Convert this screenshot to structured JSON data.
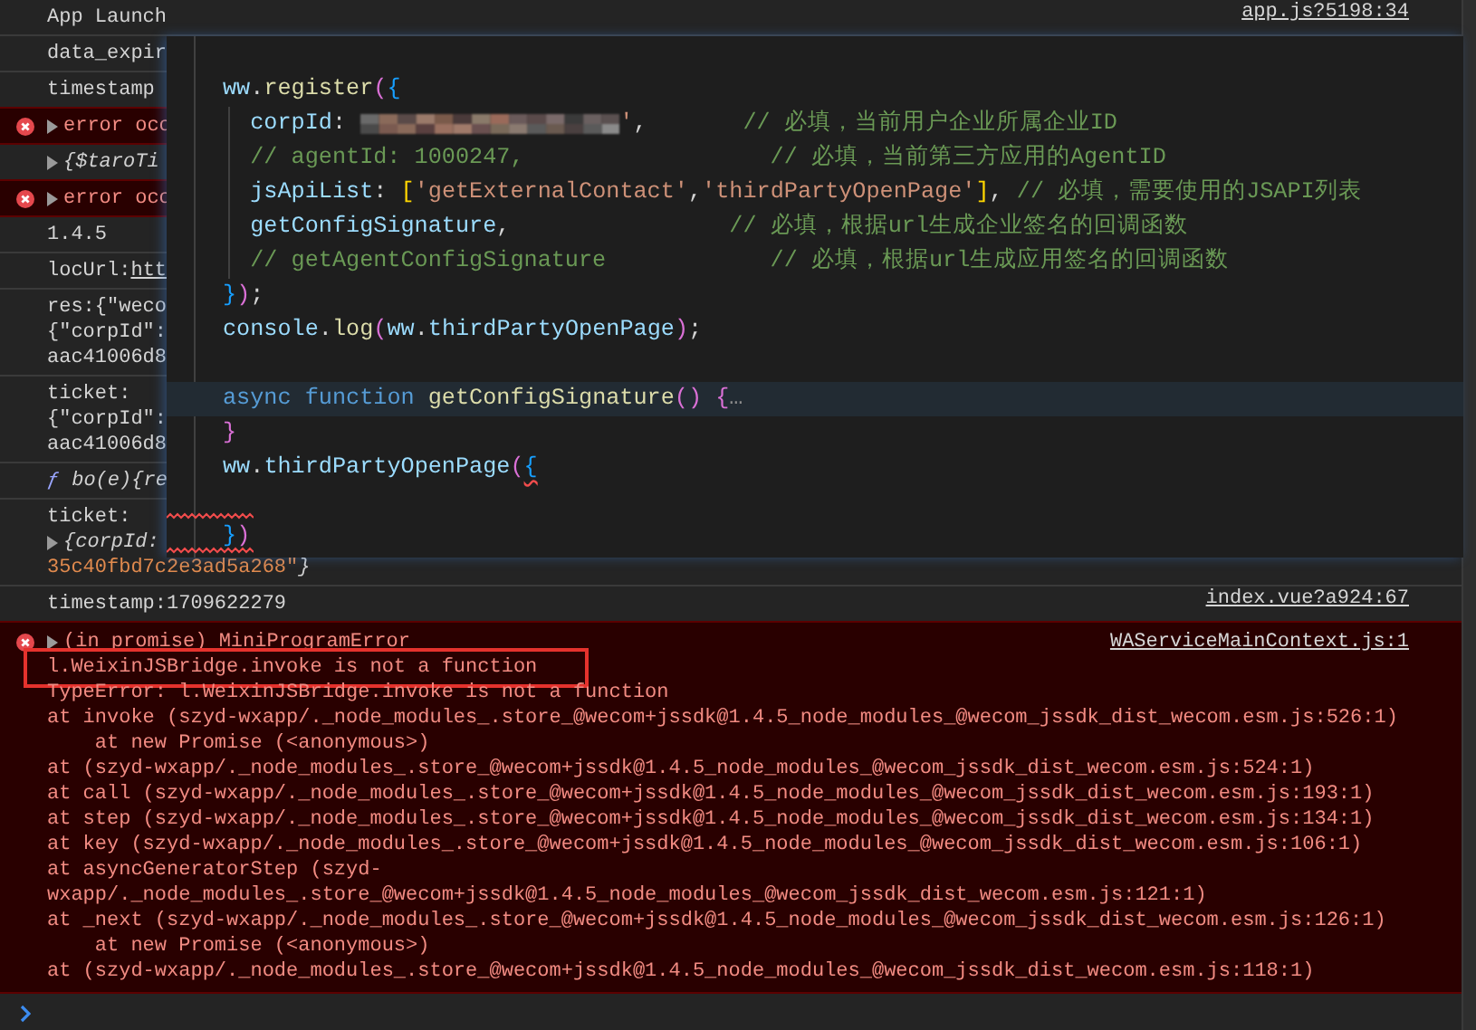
{
  "console_entries": [
    {
      "kind": "log",
      "link": "app.js?5198:34",
      "lines": [
        {
          "segments": [
            {
              "text": "App Launch",
              "kind": "plain"
            }
          ]
        }
      ]
    },
    {
      "kind": "log",
      "lines": [
        {
          "segments": [
            {
              "text": "data_expir",
              "kind": "plain"
            }
          ]
        }
      ]
    },
    {
      "kind": "log",
      "lines": [
        {
          "segments": [
            {
              "text": "timestamp",
              "kind": "plain"
            }
          ]
        }
      ]
    },
    {
      "kind": "error",
      "lines": [
        {
          "expanded": false,
          "segments": [
            {
              "text": "error occ",
              "kind": "error"
            }
          ]
        }
      ]
    },
    {
      "kind": "log",
      "lines": [
        {
          "expanded": false,
          "segments": [
            {
              "text": "{$taroTi",
              "kind": "italic"
            }
          ]
        }
      ]
    },
    {
      "kind": "error",
      "lines": [
        {
          "expanded": false,
          "segments": [
            {
              "text": "error occ",
              "kind": "error"
            }
          ]
        }
      ]
    },
    {
      "kind": "log",
      "lines": [
        {
          "segments": [
            {
              "text": "1.4.5",
              "kind": "plain"
            }
          ]
        }
      ]
    },
    {
      "kind": "log",
      "lines": [
        {
          "segments": [
            {
              "text": "locUrl:",
              "kind": "plain"
            },
            {
              "text": "htt",
              "kind": "link"
            }
          ]
        }
      ]
    },
    {
      "kind": "log",
      "lines": [
        {
          "segments": [
            {
              "text": "res:{\"weco",
              "kind": "plain"
            }
          ]
        },
        {
          "segments": [
            {
              "text": "{\"corpId\":",
              "kind": "plain"
            }
          ]
        },
        {
          "segments": [
            {
              "text": "aac41006d8",
              "kind": "plain"
            }
          ]
        }
      ]
    },
    {
      "kind": "log",
      "lines": [
        {
          "segments": [
            {
              "text": "ticket:",
              "kind": "plain"
            }
          ]
        },
        {
          "segments": [
            {
              "text": "{\"corpId\":",
              "kind": "plain"
            }
          ]
        },
        {
          "segments": [
            {
              "text": "aac41006d8",
              "kind": "plain"
            }
          ]
        }
      ]
    },
    {
      "kind": "log",
      "lines": [
        {
          "segments": [
            {
              "text": "ƒ",
              "kind": "fn"
            },
            {
              "text": "bo(e){re",
              "kind": "italic"
            }
          ]
        }
      ]
    },
    {
      "kind": "log",
      "lines": [
        {
          "segments": [
            {
              "text": "ticket:",
              "kind": "plain"
            }
          ]
        },
        {
          "expanded": false,
          "segments": [
            {
              "text": "{corpId:",
              "kind": "italic"
            }
          ]
        },
        {
          "segments": [
            {
              "text": "35c40fbd7c2e3ad5a268\"",
              "kind": "string"
            },
            {
              "text": "}",
              "kind": "italic"
            }
          ]
        }
      ]
    },
    {
      "kind": "log",
      "link": "index.vue?a924:67",
      "lines": [
        {
          "segments": [
            {
              "text": "timestamp:1709622279",
              "kind": "plain"
            }
          ]
        }
      ]
    }
  ],
  "error_block": {
    "expanded": false,
    "link": "WAServiceMainContext.js:1",
    "lines": [
      {
        "text": "(in promise) MiniProgramError",
        "highlighted": false
      },
      {
        "text": "l.WeixinJSBridge.invoke is not a function",
        "highlighted": true
      },
      {
        "text": "TypeError: l.WeixinJSBridge.invoke is not a function",
        "highlighted": false
      },
      {
        "text": "at invoke (szyd-wxapp/._node_modules_.store_@wecom+jssdk@1.4.5_node_modules_@wecom_jssdk_dist_wecom.esm.js:526:1)",
        "highlighted": false
      },
      {
        "text": "    at new Promise (<anonymous>)",
        "highlighted": false
      },
      {
        "text": "at (szyd-wxapp/._node_modules_.store_@wecom+jssdk@1.4.5_node_modules_@wecom_jssdk_dist_wecom.esm.js:524:1)",
        "highlighted": false
      },
      {
        "text": "at call (szyd-wxapp/._node_modules_.store_@wecom+jssdk@1.4.5_node_modules_@wecom_jssdk_dist_wecom.esm.js:193:1)",
        "highlighted": false
      },
      {
        "text": "at step (szyd-wxapp/._node_modules_.store_@wecom+jssdk@1.4.5_node_modules_@wecom_jssdk_dist_wecom.esm.js:134:1)",
        "highlighted": false
      },
      {
        "text": "at key (szyd-wxapp/._node_modules_.store_@wecom+jssdk@1.4.5_node_modules_@wecom_jssdk_dist_wecom.esm.js:106:1)",
        "highlighted": false
      },
      {
        "text": "at asyncGeneratorStep (szyd-",
        "highlighted": false
      },
      {
        "text": "wxapp/._node_modules_.store_@wecom+jssdk@1.4.5_node_modules_@wecom_jssdk_dist_wecom.esm.js:121:1)",
        "highlighted": false
      },
      {
        "text": "at _next (szyd-wxapp/._node_modules_.store_@wecom+jssdk@1.4.5_node_modules_@wecom_jssdk_dist_wecom.esm.js:126:1)",
        "highlighted": false
      },
      {
        "text": "    at new Promise (<anonymous>)",
        "highlighted": false
      },
      {
        "text": "at (szyd-wxapp/._node_modules_.store_@wecom+jssdk@1.4.5_node_modules_@wecom_jssdk_dist_wecom.esm.js:118:1)",
        "highlighted": false
      }
    ]
  },
  "code_popup": {
    "lines": [
      {
        "indented": false,
        "highlighted": false,
        "error": false,
        "segments": [
          {
            "text": "ww",
            "kind": "var"
          },
          {
            "text": ".",
            "kind": "punct"
          },
          {
            "text": "register",
            "kind": "func"
          },
          {
            "text": "(",
            "kind": "b2"
          },
          {
            "text": "{",
            "kind": "b3"
          }
        ]
      },
      {
        "indented": true,
        "highlighted": false,
        "error": false,
        "segments": [
          {
            "text": "corpId",
            "kind": "var"
          },
          {
            "text": ": ",
            "kind": "punct"
          },
          {
            "kind": "redacted"
          },
          {
            "text": "'",
            "kind": "string"
          },
          {
            "text": ",       ",
            "kind": "punct"
          },
          {
            "text": "// 必填，当前用户企业所属企业ID",
            "kind": "comment"
          }
        ]
      },
      {
        "indented": true,
        "highlighted": false,
        "error": false,
        "segments": [
          {
            "text": "// agentId: 1000247,                  ",
            "kind": "comment"
          },
          {
            "text": "// 必填，当前第三方应用的AgentID",
            "kind": "comment"
          }
        ]
      },
      {
        "indented": true,
        "highlighted": false,
        "error": false,
        "segments": [
          {
            "text": "jsApiList",
            "kind": "var"
          },
          {
            "text": ": ",
            "kind": "punct"
          },
          {
            "text": "[",
            "kind": "b1"
          },
          {
            "text": "'getExternalContact'",
            "kind": "string"
          },
          {
            "text": ",",
            "kind": "punct"
          },
          {
            "text": "'thirdPartyOpenPage'",
            "kind": "string"
          },
          {
            "text": "]",
            "kind": "b1"
          },
          {
            "text": ", ",
            "kind": "punct"
          },
          {
            "text": "// 必填，需要使用的JSAPI列表",
            "kind": "comment"
          }
        ]
      },
      {
        "indented": true,
        "highlighted": false,
        "error": false,
        "segments": [
          {
            "text": "getConfigSignature",
            "kind": "var"
          },
          {
            "text": ",                ",
            "kind": "punct"
          },
          {
            "text": "// 必填，根据url生成企业签名的回调函数",
            "kind": "comment"
          }
        ]
      },
      {
        "indented": true,
        "highlighted": false,
        "error": false,
        "segments": [
          {
            "text": "// getAgentConfigSignature            ",
            "kind": "comment"
          },
          {
            "text": "// 必填，根据url生成应用签名的回调函数",
            "kind": "comment"
          }
        ]
      },
      {
        "indented": false,
        "highlighted": false,
        "error": false,
        "segments": [
          {
            "text": "}",
            "kind": "b3"
          },
          {
            "text": ")",
            "kind": "b2"
          },
          {
            "text": ";",
            "kind": "punct"
          }
        ]
      },
      {
        "indented": false,
        "highlighted": false,
        "error": false,
        "segments": [
          {
            "text": "console",
            "kind": "var"
          },
          {
            "text": ".",
            "kind": "punct"
          },
          {
            "text": "log",
            "kind": "func"
          },
          {
            "text": "(",
            "kind": "b2"
          },
          {
            "text": "ww",
            "kind": "var"
          },
          {
            "text": ".",
            "kind": "punct"
          },
          {
            "text": "thirdPartyOpenPage",
            "kind": "var"
          },
          {
            "text": ")",
            "kind": "b2"
          },
          {
            "text": ";",
            "kind": "punct"
          }
        ]
      },
      {
        "indented": false,
        "highlighted": false,
        "error": false
      },
      {
        "indented": false,
        "highlighted": true,
        "error": false,
        "segments": [
          {
            "text": "async function ",
            "kind": "keyword"
          },
          {
            "text": "getConfigSignature",
            "kind": "func"
          },
          {
            "text": "() {",
            "kind": "b2"
          },
          {
            "text": "…",
            "kind": "fold"
          }
        ]
      },
      {
        "indented": false,
        "highlighted": false,
        "error": false,
        "segments": [
          {
            "text": "}",
            "kind": "b2"
          }
        ]
      },
      {
        "indented": false,
        "highlighted": false,
        "error": false,
        "segments": [
          {
            "text": "ww",
            "kind": "var"
          },
          {
            "text": ".",
            "kind": "punct"
          },
          {
            "text": "thirdPartyOpenPage",
            "kind": "var"
          },
          {
            "text": "(",
            "kind": "b2"
          },
          {
            "text": "{",
            "kind": "b3err"
          }
        ]
      },
      {
        "indented": false,
        "highlighted": false,
        "error": true
      },
      {
        "indented": false,
        "highlighted": false,
        "error": true,
        "segments": [
          {
            "text": "}",
            "kind": "b3"
          },
          {
            "text": ")",
            "kind": "b2"
          }
        ]
      }
    ]
  }
}
